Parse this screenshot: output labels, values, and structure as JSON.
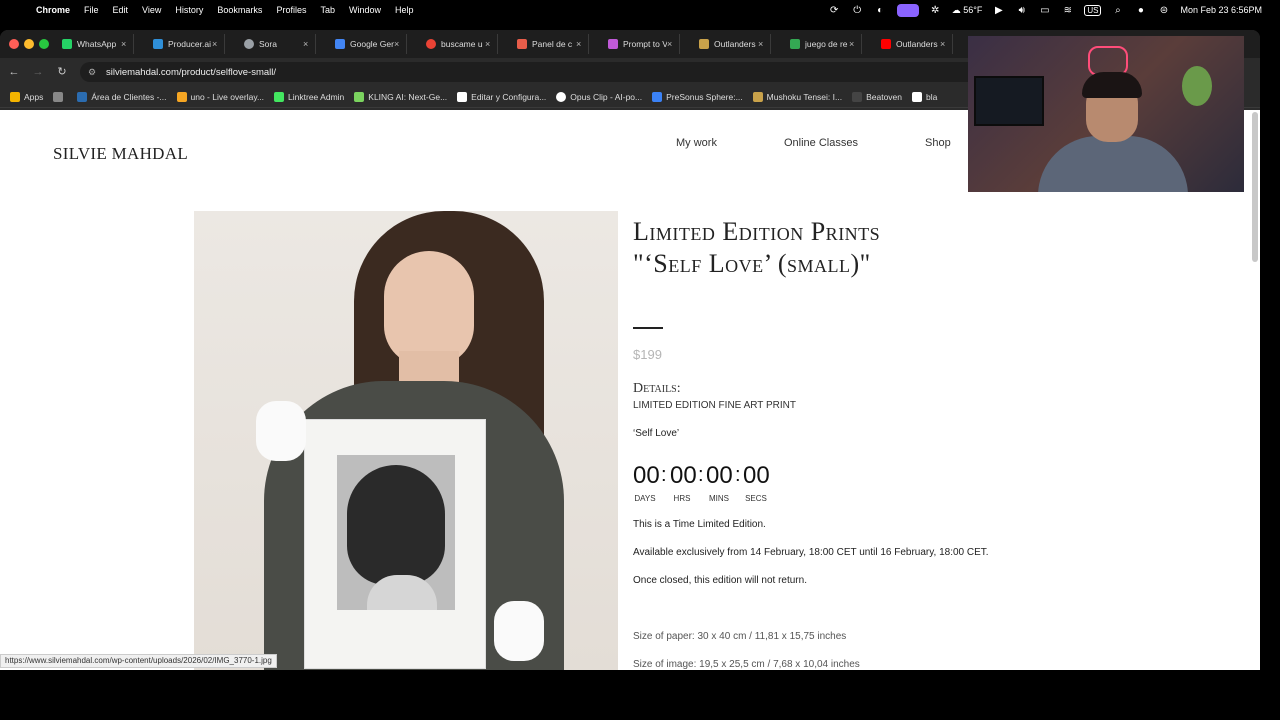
{
  "menubar": {
    "app": "Chrome",
    "items": [
      "File",
      "Edit",
      "View",
      "History",
      "Bookmarks",
      "Profiles",
      "Tab",
      "Window",
      "Help"
    ],
    "weather": "56°F",
    "datetime": "Mon Feb 23  6:56PM"
  },
  "tabs": [
    {
      "label": "WhatsApp",
      "color": "#25d366"
    },
    {
      "label": "Producer.ai",
      "color": "#2f8fd8"
    },
    {
      "label": "Sora",
      "color": "#9aa0a6"
    },
    {
      "label": "Google Gen",
      "color": "#4285f4"
    },
    {
      "label": "buscame u",
      "color": "#ea4335"
    },
    {
      "label": "Panel de c",
      "color": "#e85d4a"
    },
    {
      "label": "Prompt to V",
      "color": "#c05ad8"
    },
    {
      "label": "Outlanders",
      "color": "#c9a24a"
    },
    {
      "label": "juego de re",
      "color": "#34a853"
    },
    {
      "label": "Outlanders",
      "color": "#ff0000"
    }
  ],
  "address": {
    "url": "silviemahdal.com/product/selflove-small/"
  },
  "bookmarks": [
    {
      "label": "Apps",
      "color": "#f4b400"
    },
    {
      "label": "Área de Clientes -...",
      "color": "#2b6cb0"
    },
    {
      "label": "uno - Live overlay...",
      "color": "#f6a623"
    },
    {
      "label": "Linktree Admin",
      "color": "#43e660"
    },
    {
      "label": "KLING AI: Next-Ge...",
      "color": "#7bd35f"
    },
    {
      "label": "Editar y Configura...",
      "color": "#ffffff"
    },
    {
      "label": "Opus Clip - AI-po...",
      "color": "#ffffff"
    },
    {
      "label": "PreSonus Sphere:...",
      "color": "#3b82f6"
    },
    {
      "label": "Mushoku Tensei: I...",
      "color": "#c9a24a"
    },
    {
      "label": "Beatoven",
      "color": "#444444"
    },
    {
      "label": "bla",
      "color": "#ffffff"
    }
  ],
  "site": {
    "brand": "SILVIE MAHDAL",
    "nav": [
      "My work",
      "Online Classes",
      "Shop"
    ]
  },
  "product": {
    "title_line1": "Limited Edition Prints",
    "title_line2": "\"‘Self Love’ (small)\"",
    "price": "$199",
    "details_heading": "Details:",
    "details_sub": "LIMITED EDITION FINE ART PRINT",
    "name": "‘Self Love’",
    "countdown": {
      "days": "00",
      "hrs": "00",
      "mins": "00",
      "secs": "00",
      "days_label": "DAYS",
      "hrs_label": "HRS",
      "mins_label": "MINS",
      "secs_label": "SECS"
    },
    "p1": "This is a Time Limited Edition.",
    "p2": "Available exclusively from 14 February, 18:00 CET until 16 February, 18:00 CET.",
    "p3": "Once closed, this edition will not return.",
    "paper_size": "Size of paper:  30 x 40 cm / 11,81 x 15,75 inches",
    "image_size": "Size of image: 19,5 x 25,5 cm / 7,68 x 10,04 inches"
  },
  "status_url": "https://www.silviemahdal.com/wp-content/uploads/2026/02/IMG_3770-1.jpg"
}
